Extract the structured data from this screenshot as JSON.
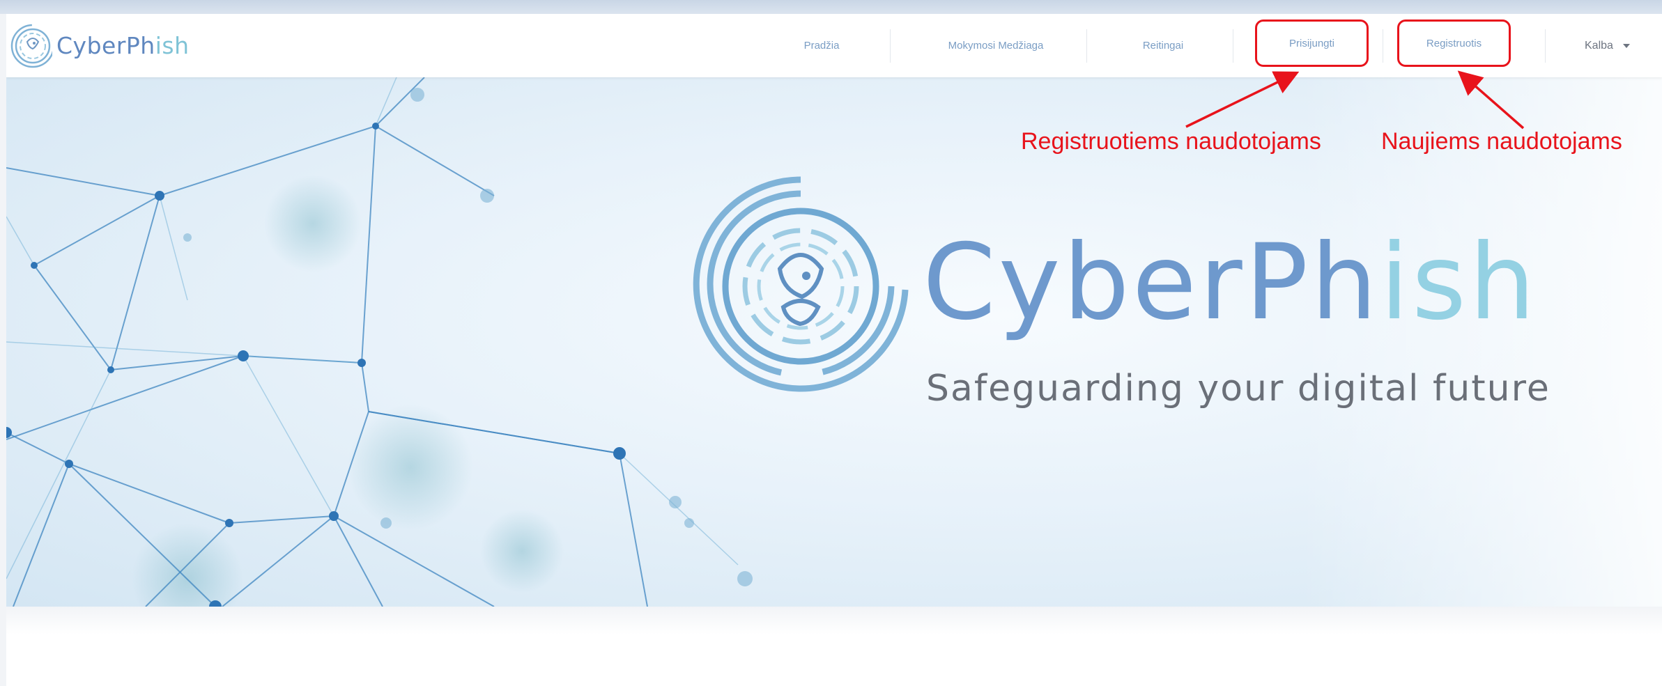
{
  "brand": {
    "name_main": "CyberPh",
    "name_accent": "ish",
    "logo_icon": "cyberphish-fish-logo"
  },
  "nav": {
    "items": [
      {
        "label": "Pradžia"
      },
      {
        "label": "Mokymosi Medžiaga"
      },
      {
        "label": "Reitingai"
      },
      {
        "label": "Prisijungti"
      },
      {
        "label": "Registruotis"
      }
    ],
    "language_label": "Kalba"
  },
  "hero": {
    "title_main": "CyberPh",
    "title_accent": "ish",
    "subtitle": "Safeguarding your digital future"
  },
  "annotations": {
    "login_note": "Registruotiems naudotojams",
    "register_note": "Naujiems naudotojams",
    "color": "#e8131b"
  },
  "colors": {
    "brand_blue": "#6e99cd",
    "brand_teal": "#94d1e3",
    "nav_text": "#7a9dc4"
  }
}
